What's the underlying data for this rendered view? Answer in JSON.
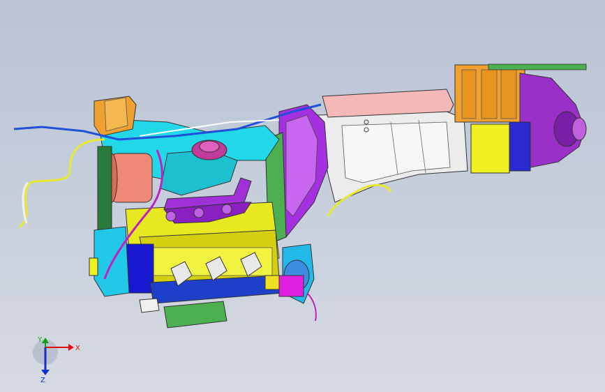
{
  "viewport": {
    "axes": {
      "x_label": "X",
      "y_label": "Y",
      "z_label": "Z"
    },
    "colors": {
      "x_axis": "#e01010",
      "y_axis": "#10a010",
      "z_axis": "#1030d0",
      "background_top": "#b9c3d4",
      "background_bottom": "#d6dae2"
    },
    "model_icon": "cad-engine-transmission-assembly"
  }
}
